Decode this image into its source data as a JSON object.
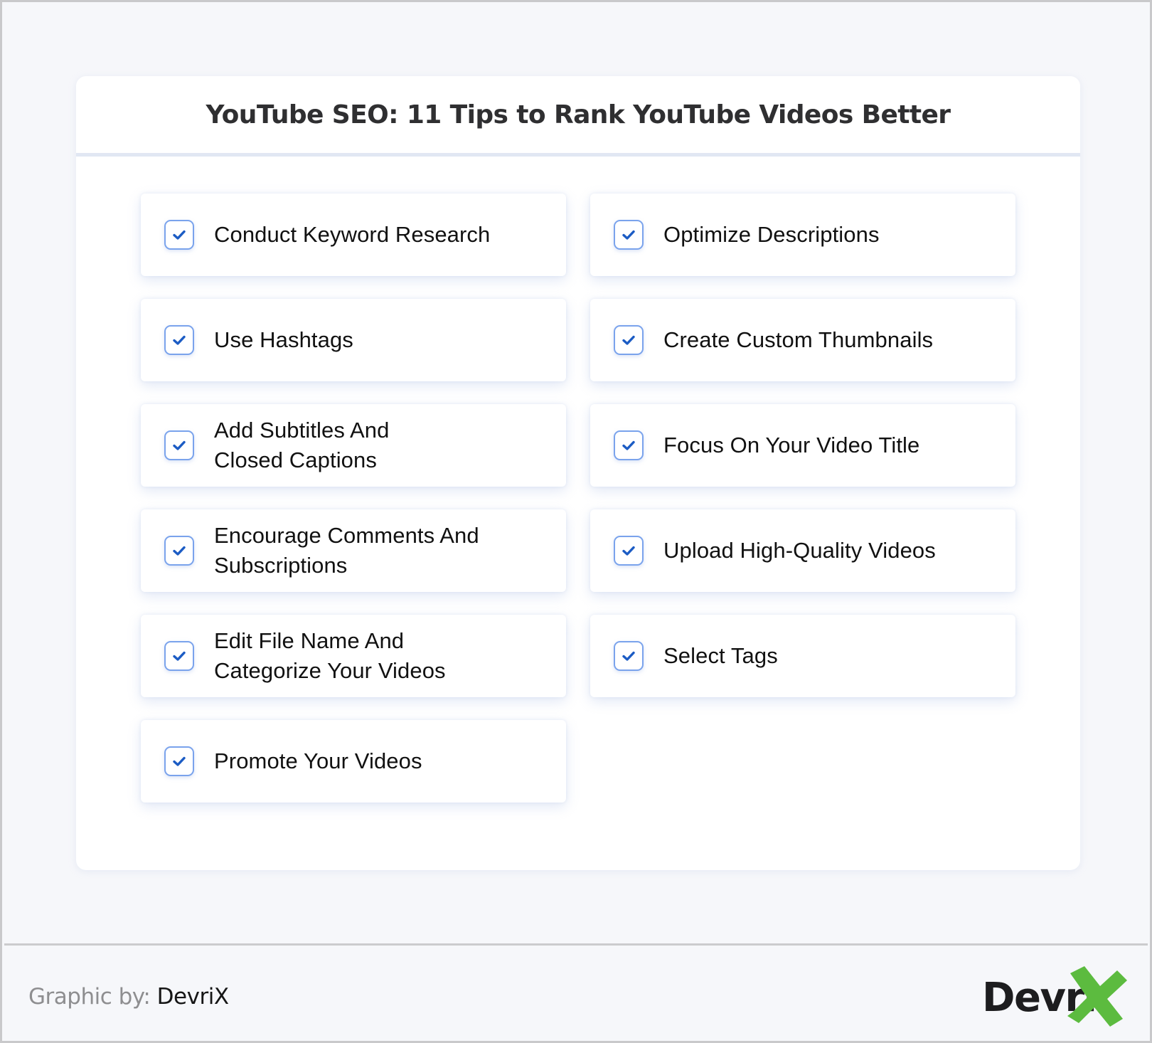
{
  "header": {
    "title": "YouTube SEO: 11 Tips to Rank YouTube Videos Better"
  },
  "tips": [
    {
      "label": "Conduct Keyword Research",
      "checked": true
    },
    {
      "label": "Optimize Descriptions",
      "checked": true
    },
    {
      "label": "Use Hashtags",
      "checked": true
    },
    {
      "label": "Create Custom Thumbnails",
      "checked": true
    },
    {
      "label": "Add Subtitles And Closed Captions",
      "checked": true
    },
    {
      "label": "Focus On Your Video Title",
      "checked": true
    },
    {
      "label": "Encourage Comments And Subscriptions",
      "checked": true
    },
    {
      "label": "Upload High-Quality Videos",
      "checked": true
    },
    {
      "label": "Edit File Name And Categorize Your Videos",
      "checked": true
    },
    {
      "label": "Select Tags",
      "checked": true
    },
    {
      "label": "Promote Your Videos",
      "checked": true
    }
  ],
  "footer": {
    "credit_prefix": "Graphic by: ",
    "credit_name": "DevriX",
    "logo_text": "Devri",
    "logo_mark": "X"
  },
  "colors": {
    "checkbox_border": "#7aa3ec",
    "check_mark": "#1c5cc4",
    "logo_green": "#5cbb3f",
    "divider": "#e1e7f3"
  }
}
